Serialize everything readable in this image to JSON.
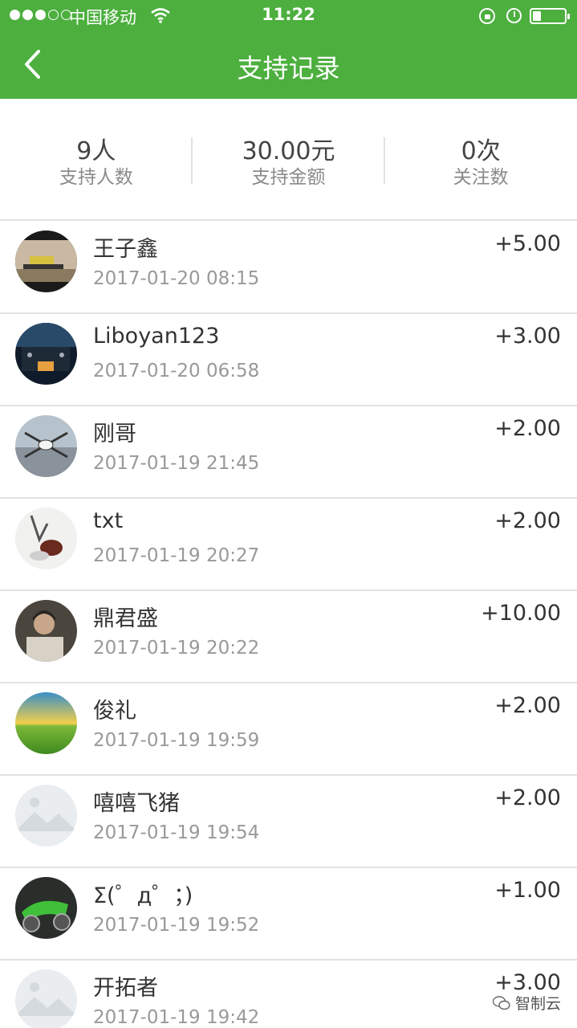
{
  "status_bar": {
    "carrier": "中国移动",
    "time": "11:22",
    "signal_icon": "signal-dots-icon",
    "wifi_icon": "wifi-icon",
    "battery_icon": "battery-icon"
  },
  "header": {
    "title": "支持记录",
    "back_icon": "chevron-left-icon",
    "background_color": "#4caf3e"
  },
  "stats": [
    {
      "value": "9人",
      "label": "支持人数"
    },
    {
      "value": "30.00元",
      "label": "支持金额"
    },
    {
      "value": "0次",
      "label": "关注数"
    }
  ],
  "records": [
    {
      "name": "王子鑫",
      "time": "2017-01-20 08:15",
      "amount": "+5.00"
    },
    {
      "name": "Liboyan123",
      "time": "2017-01-20 06:58",
      "amount": "+3.00"
    },
    {
      "name": "刚哥",
      "time": "2017-01-19 21:45",
      "amount": "+2.00"
    },
    {
      "name": "txt",
      "time": "2017-01-19 20:27",
      "amount": "+2.00"
    },
    {
      "name": "鼎君盛",
      "time": "2017-01-19 20:22",
      "amount": "+10.00"
    },
    {
      "name": "俊礼",
      "time": "2017-01-19 19:59",
      "amount": "+2.00"
    },
    {
      "name": "嘻嘻飞猪",
      "time": "2017-01-19 19:54",
      "amount": "+2.00"
    },
    {
      "name": "Σ(゜д゜；)",
      "time": "2017-01-19 19:52",
      "amount": "+1.00"
    },
    {
      "name": "开拓者",
      "time": "2017-01-19 19:42",
      "amount": "+3.00"
    }
  ],
  "watermark": {
    "text": "智制云",
    "icon": "wechat-icon"
  }
}
